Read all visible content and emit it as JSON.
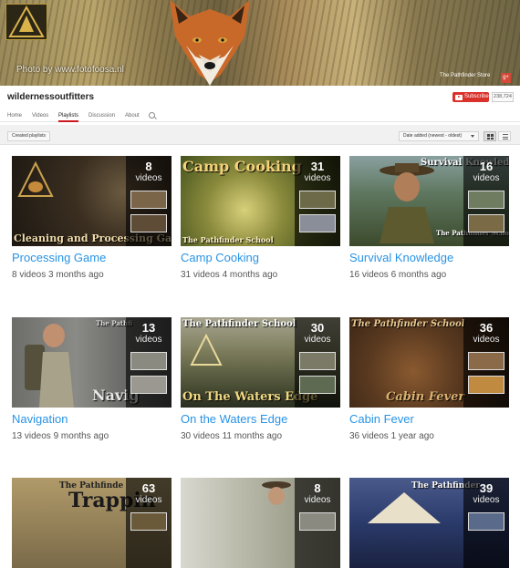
{
  "banner": {
    "photo_credit": "Photo by www.fotofoosa.nl",
    "store_label": "The Pathfinder Store",
    "gplus_label": "g+"
  },
  "channel": {
    "name": "wildernessoutfitters",
    "subscribe_label": "Subscribe",
    "subscriber_count": "238,724"
  },
  "tabs": [
    {
      "label": "Home"
    },
    {
      "label": "Videos"
    },
    {
      "label": "Playlists",
      "active": true
    },
    {
      "label": "Discussion"
    },
    {
      "label": "About"
    }
  ],
  "toolbar": {
    "created_playlists": "Created playlists",
    "sort_label": "Date added (newest - oldest)"
  },
  "videos_word": "videos",
  "playlists": [
    {
      "title": "Processing Game",
      "count": "8",
      "meta_count": "8 videos",
      "meta_age": "3 months ago",
      "thumb_text": "Cleaning and Processing Game"
    },
    {
      "title": "Camp Cooking",
      "count": "31",
      "meta_count": "31 videos",
      "meta_age": "4 months ago",
      "thumb_text": "Camp Cooking",
      "thumb_sub": "The Pathfinder School"
    },
    {
      "title": "Survival Knowledge",
      "count": "16",
      "meta_count": "16 videos",
      "meta_age": "6 months ago",
      "thumb_text": "Survival Knowledge",
      "thumb_sub": "The Pathfinder School"
    },
    {
      "title": "Navigation",
      "count": "13",
      "meta_count": "13 videos",
      "meta_age": "9 months ago",
      "thumb_text": "Navig",
      "thumb_sub": "The Pathfi"
    },
    {
      "title": "On the Waters Edge",
      "count": "30",
      "meta_count": "30 videos",
      "meta_age": "11 months ago",
      "thumb_text": "On The Waters Edge",
      "thumb_sub": "The Pathfinder School"
    },
    {
      "title": "Cabin Fever",
      "count": "36",
      "meta_count": "36 videos",
      "meta_age": "1 year ago",
      "thumb_text": "Cabin Fever",
      "thumb_sub": "The Pathfinder School"
    },
    {
      "title": "",
      "count": "63",
      "thumb_text": "Trappin",
      "thumb_sub": "The Pathfinde"
    },
    {
      "title": "",
      "count": "8"
    },
    {
      "title": "",
      "count": "39",
      "thumb_sub": "The Pathfinder"
    }
  ]
}
